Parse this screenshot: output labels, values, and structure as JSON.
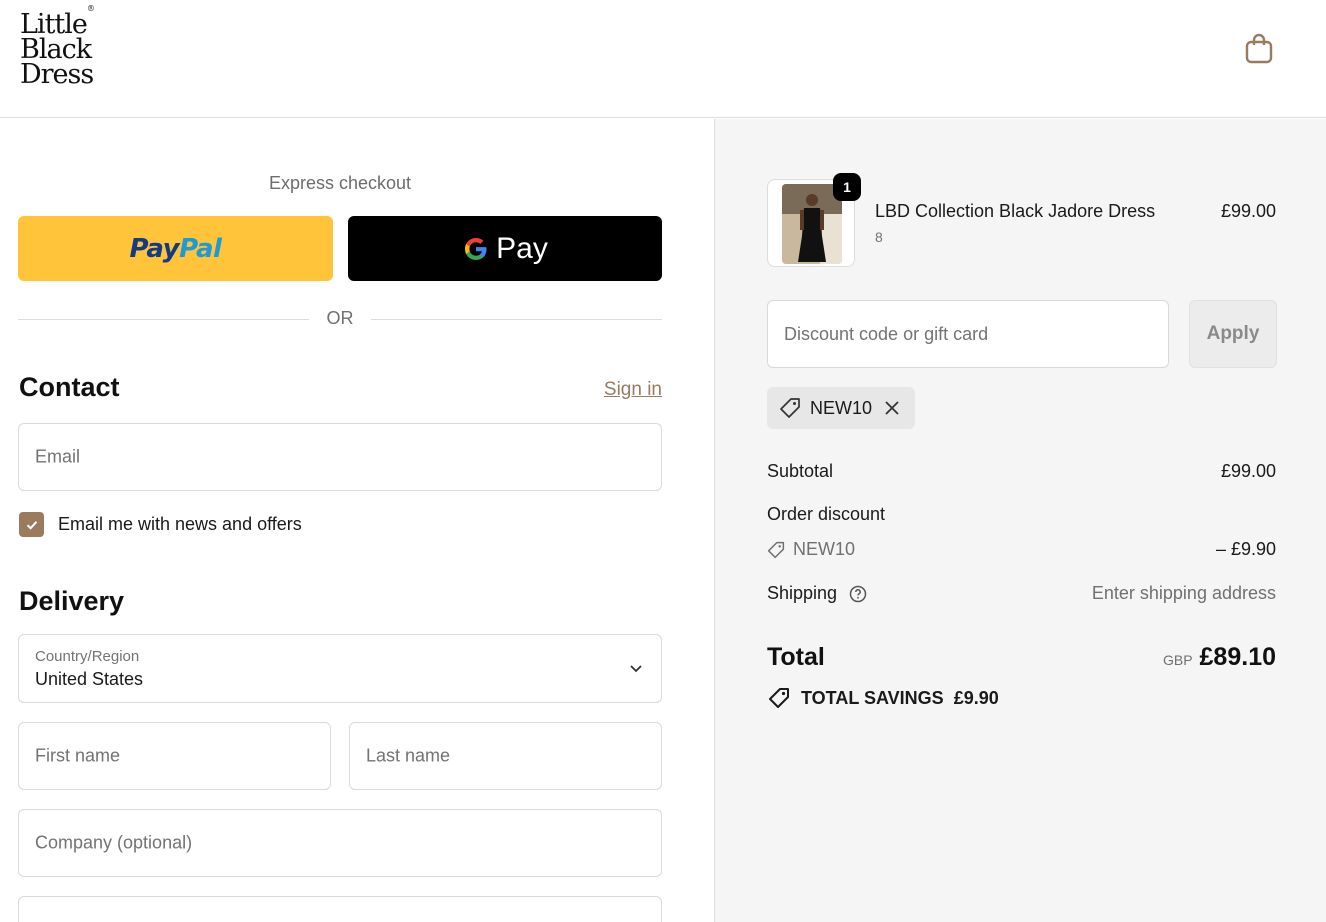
{
  "header": {
    "logo_lines": [
      "Little",
      "Black",
      "Dress"
    ],
    "logo_mark": "®",
    "cart_icon": "shopping-bag-icon"
  },
  "express": {
    "title": "Express checkout",
    "paypal_part1": "Pay",
    "paypal_part2": "Pal",
    "gpay_label": "Pay",
    "or_label": "OR"
  },
  "contact": {
    "title": "Contact",
    "signin_label": "Sign in",
    "email_placeholder": "Email",
    "newsletter_label": "Email me with news and offers",
    "newsletter_checked": true
  },
  "delivery": {
    "title": "Delivery",
    "country_label": "Country/Region",
    "country_value": "United States",
    "first_name_placeholder": "First name",
    "last_name_placeholder": "Last name",
    "company_placeholder": "Company (optional)"
  },
  "order": {
    "item": {
      "name": "LBD Collection Black Jadore Dress",
      "variant": "8",
      "price": "£99.00",
      "quantity": "1"
    },
    "discount_placeholder": "Discount code or gift card",
    "apply_label": "Apply",
    "applied_code": "NEW10",
    "subtotal_label": "Subtotal",
    "subtotal_value": "£99.00",
    "order_discount_label": "Order discount",
    "discount_code": "NEW10",
    "discount_value": "– £9.90",
    "shipping_label": "Shipping",
    "shipping_value": "Enter shipping address",
    "total_label": "Total",
    "currency": "GBP",
    "total_value": "£89.10",
    "savings_label": "TOTAL SAVINGS",
    "savings_value": "£9.90"
  },
  "colors": {
    "accent": "#9a7b5d",
    "paypal_yellow": "#ffc43a",
    "paypal_dark_blue": "#123b85",
    "paypal_light_blue": "#1f9ad6",
    "gpay_black": "#000000",
    "summary_bg": "#f5f5f5"
  }
}
